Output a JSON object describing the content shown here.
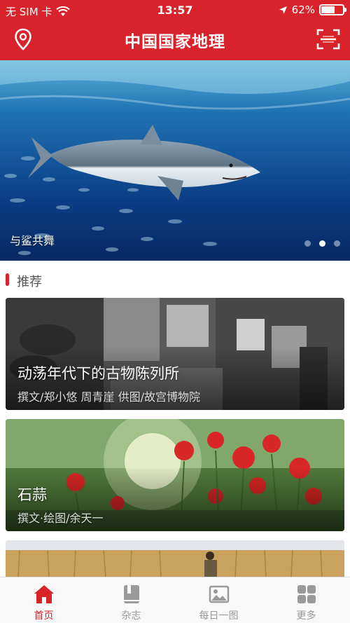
{
  "status_bar": {
    "carrier": "无 SIM 卡",
    "time": "13:57",
    "battery_text": "62%",
    "battery_level": 0.62
  },
  "nav": {
    "title": "中国国家地理",
    "left_icon": "location-pin-icon",
    "right_icon": "scan-icon"
  },
  "hero": {
    "caption": "与鲨共舞",
    "slide_count": 3,
    "active_slide": 2
  },
  "section": {
    "title": "推荐"
  },
  "cards": [
    {
      "title": "动荡年代下的古物陈列所",
      "byline": "撰文/郑小悠 周青崖  供图/故宫博物院"
    },
    {
      "title": "石蒜",
      "byline": "撰文·绘图/余天一"
    }
  ],
  "tabs": [
    {
      "label": "首页",
      "icon": "home-icon",
      "active": true
    },
    {
      "label": "杂志",
      "icon": "magazine-icon",
      "active": false
    },
    {
      "label": "每日一图",
      "icon": "image-icon",
      "active": false
    },
    {
      "label": "更多",
      "icon": "grid-icon",
      "active": false
    }
  ],
  "colors": {
    "brand_red": "#d8232a",
    "tab_inactive": "#9a9a9a"
  }
}
